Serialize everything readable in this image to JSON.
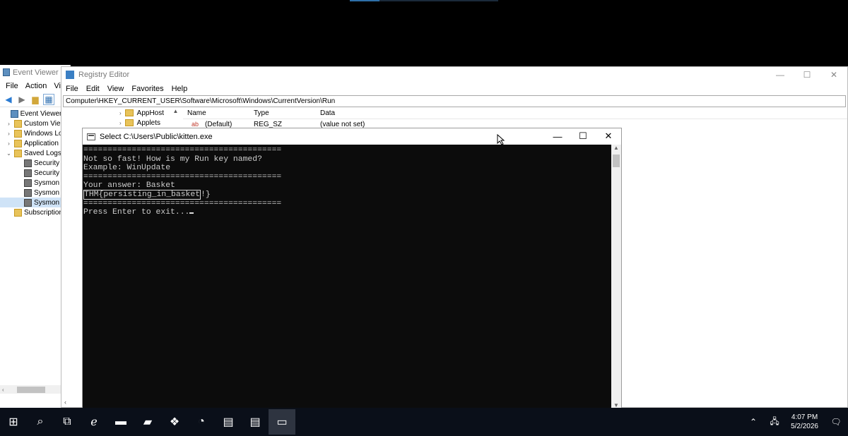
{
  "event_viewer": {
    "title": "Event Viewer",
    "menu": [
      "File",
      "Action",
      "Vie"
    ],
    "tree": [
      {
        "label": "Event Viewer (L",
        "expander": "",
        "icon": "viewer",
        "selected": false
      },
      {
        "label": "Custom Vie",
        "expander": "›",
        "icon": "folder",
        "selected": false
      },
      {
        "label": "Windows Lo",
        "expander": "›",
        "icon": "folder",
        "selected": false
      },
      {
        "label": "Application",
        "expander": "›",
        "icon": "folder",
        "selected": false
      },
      {
        "label": "Saved Logs",
        "expander": "⌄",
        "icon": "folder",
        "selected": false
      },
      {
        "label": "Security",
        "expander": "",
        "icon": "log",
        "selected": false
      },
      {
        "label": "Security",
        "expander": "",
        "icon": "log",
        "selected": false
      },
      {
        "label": "Sysmon",
        "expander": "",
        "icon": "log",
        "selected": false
      },
      {
        "label": "Sysmon",
        "expander": "",
        "icon": "log",
        "selected": false
      },
      {
        "label": "Sysmon",
        "expander": "",
        "icon": "log",
        "selected": true
      },
      {
        "label": "Subscription",
        "expander": "",
        "icon": "folder",
        "selected": false
      }
    ]
  },
  "registry_editor": {
    "title": "Registry Editor",
    "menu": [
      "File",
      "Edit",
      "View",
      "Favorites",
      "Help"
    ],
    "address": "Computer\\HKEY_CURRENT_USER\\Software\\Microsoft\\Windows\\CurrentVersion\\Run",
    "keys": [
      "AppHost",
      "Applets"
    ],
    "columns": [
      "Name",
      "Type",
      "Data"
    ],
    "rows": [
      {
        "name": "(Default)",
        "type": "REG_SZ",
        "data": "(value not set)"
      }
    ]
  },
  "console": {
    "title": "Select C:\\Users\\Public\\kitten.exe",
    "lines": [
      "=========================================",
      "Not so fast! How is my Run key named?",
      "Example: WinUpdate",
      "=========================================",
      "Your answer: Basket",
      "THM{persisting_in_basket!}",
      "=========================================",
      "Press Enter to exit..."
    ],
    "selection": "THM{persisting_in_basket"
  },
  "taskbar": {
    "items": [
      {
        "icon": "windows-start-icon",
        "glyph": "⊞",
        "active": false
      },
      {
        "icon": "search-icon",
        "glyph": "⌕",
        "active": false
      },
      {
        "icon": "task-view-icon",
        "glyph": "⧉",
        "active": false
      },
      {
        "icon": "internet-explorer-icon",
        "glyph": "ℯ",
        "active": false
      },
      {
        "icon": "file-explorer-icon",
        "glyph": "▬",
        "active": false
      },
      {
        "icon": "server-manager-icon",
        "glyph": "▰",
        "active": false
      },
      {
        "icon": "registry-editor-icon",
        "glyph": "❖",
        "active": false
      },
      {
        "icon": "clock-app-icon",
        "glyph": "◔",
        "active": false
      },
      {
        "icon": "event-viewer-icon",
        "glyph": "▤",
        "active": false
      },
      {
        "icon": "event-viewer-2-icon",
        "glyph": "▤",
        "active": false
      },
      {
        "icon": "console-icon",
        "glyph": "▭",
        "active": true
      }
    ],
    "time": "4:07 PM",
    "date": "5/2/2026"
  }
}
